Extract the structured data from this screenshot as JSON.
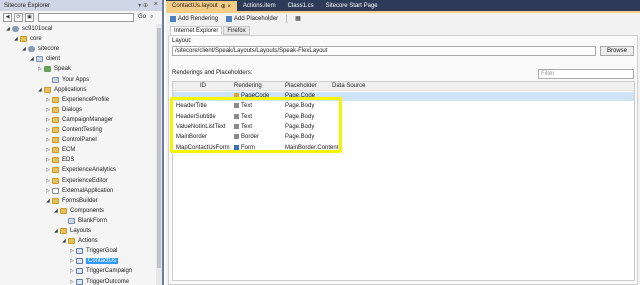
{
  "explorer": {
    "title": "Sitecore Explorer",
    "pin": "▾ ⊕",
    "go_label": "Go",
    "tree": [
      {
        "label": "sc9101ocal",
        "icon": "db",
        "tri": "◢"
      },
      {
        "label": "core",
        "icon": "folder",
        "tri": "◢"
      },
      {
        "label": "sitecore",
        "icon": "db",
        "tri": "◢"
      },
      {
        "label": "client",
        "icon": "item",
        "tri": "◢"
      },
      {
        "label": "Speak",
        "icon": "green",
        "tri": "▷"
      },
      {
        "label": "Your Apps",
        "icon": "item",
        "tri": ""
      },
      {
        "label": "Applications",
        "icon": "folder",
        "tri": "◢"
      },
      {
        "label": "ExperienceProfile",
        "icon": "folder",
        "tri": "▷"
      },
      {
        "label": "Dialogs",
        "icon": "folder",
        "tri": "▷"
      },
      {
        "label": "CampaignManager",
        "icon": "folder",
        "tri": "▷"
      },
      {
        "label": "ContentTesting",
        "icon": "folder",
        "tri": "▷"
      },
      {
        "label": "ControlPanel",
        "icon": "folder",
        "tri": "▷"
      },
      {
        "label": "ECM",
        "icon": "folder",
        "tri": "▷"
      },
      {
        "label": "EDS",
        "icon": "folder",
        "tri": "▷"
      },
      {
        "label": "ExperienceAnalytics",
        "icon": "folder",
        "tri": "▷"
      },
      {
        "label": "ExperienceEditor",
        "icon": "folder",
        "tri": "▷"
      },
      {
        "label": "ExternalApplication",
        "icon": "doc",
        "tri": "▷"
      },
      {
        "label": "FormsBuilder",
        "icon": "folder",
        "tri": "◢"
      },
      {
        "label": "Components",
        "icon": "folder",
        "tri": "◢"
      },
      {
        "label": "BlankForm",
        "icon": "item",
        "tri": ""
      },
      {
        "label": "Layouts",
        "icon": "folder",
        "tri": "◢"
      },
      {
        "label": "Actions",
        "icon": "folder",
        "tri": "◢"
      },
      {
        "label": "TriggerGoal",
        "icon": "page",
        "tri": "▷"
      },
      {
        "label": "ContactUs",
        "icon": "page",
        "tri": "▷",
        "selected": true
      },
      {
        "label": "TriggerCampaign",
        "icon": "page",
        "tri": "▷"
      },
      {
        "label": "TriggerOutcome",
        "icon": "page",
        "tri": "▷"
      }
    ]
  },
  "tabs": [
    {
      "label": "ContactUs.layout",
      "close": "⊕ ×",
      "active": true
    },
    {
      "label": "Actions.item",
      "close": "",
      "active": false
    },
    {
      "label": "Class1.cs",
      "close": "",
      "active": false
    },
    {
      "label": "Sitecore Start Page",
      "close": "",
      "active": false
    }
  ],
  "toolbar": {
    "add_rendering": "Add Rendering",
    "add_placeholder": "Add Placeholder"
  },
  "subtabs": [
    "Internet Explorer",
    "Firefox"
  ],
  "layout": {
    "label": "Layout:",
    "value": "/sitecore/client/Speak/Layouts/Layouts/Speak-FlexLayout",
    "browse": "Browse"
  },
  "renderings": {
    "label": "Renderings and Placeholders:",
    "filter_placeholder": "Filter",
    "columns": [
      "ID",
      "Rendering",
      "Placeholder",
      "Data Source"
    ],
    "rows": [
      {
        "id": "",
        "rendering": "PageCode",
        "placeholder": "Page.Code",
        "datasource": "",
        "selected": true
      },
      {
        "id": "HeaderTitle",
        "rendering": "Text",
        "placeholder": "Page.Body",
        "datasource": ""
      },
      {
        "id": "HeaderSubtitle",
        "rendering": "Text",
        "placeholder": "Page.Body",
        "datasource": ""
      },
      {
        "id": "ValueNotInListText",
        "rendering": "Text",
        "placeholder": "Page.Body",
        "datasource": ""
      },
      {
        "id": "MainBorder",
        "rendering": "Border",
        "placeholder": "Page.Body",
        "datasource": ""
      },
      {
        "id": "MapContactUsForm",
        "rendering": "Form",
        "placeholder": "MainBorder.Content",
        "datasource": ""
      }
    ]
  },
  "colors": {
    "tabbar": "#2d3b58",
    "active_tab": "#f5cc84",
    "highlight": "#f5f500",
    "selection": "#3399ff"
  }
}
